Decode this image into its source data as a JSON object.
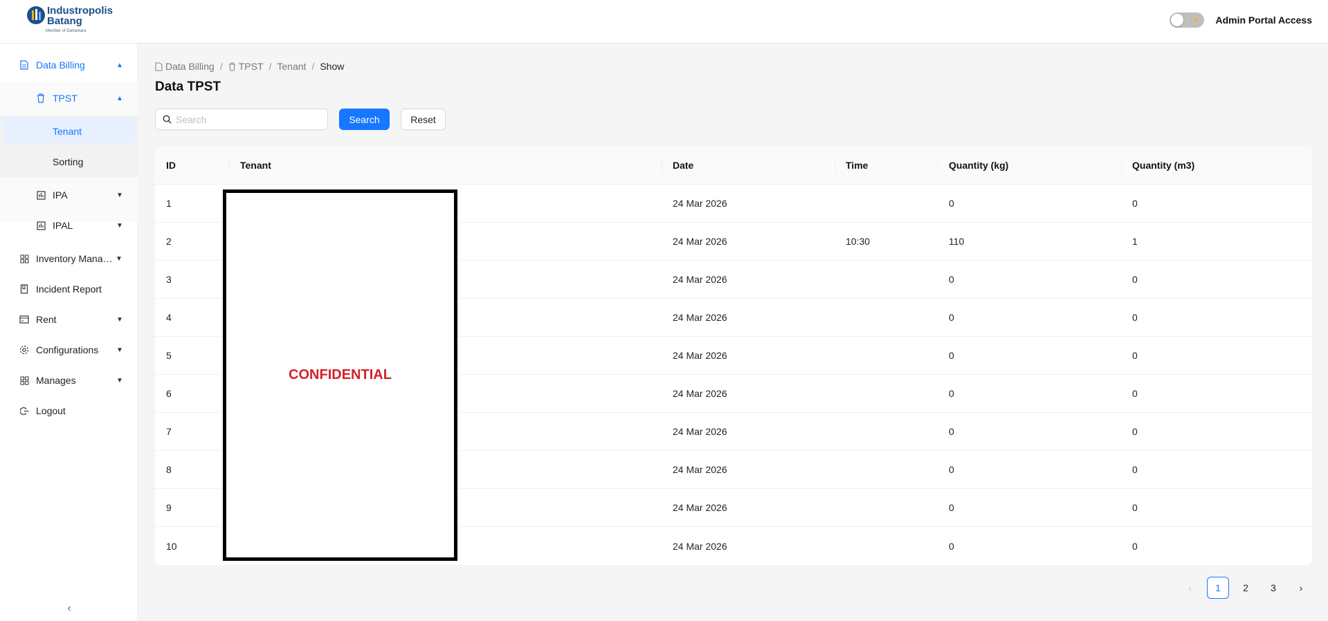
{
  "header": {
    "logo_line1": "Industropolis",
    "logo_line2": "Batang",
    "logo_sub": "Member of Danantara",
    "admin_label": "Admin Portal Access"
  },
  "sidebar": {
    "items": [
      {
        "label": "Data Billing",
        "icon": "document-icon"
      },
      {
        "label": "TPST",
        "icon": "trash-icon"
      },
      {
        "label": "Tenant"
      },
      {
        "label": "Sorting"
      },
      {
        "label": "IPA",
        "icon": "meter-icon"
      },
      {
        "label": "IPAL",
        "icon": "meter-icon"
      },
      {
        "label": "Inventory Management",
        "icon": "grid-icon"
      },
      {
        "label": "Incident Report",
        "icon": "book-icon"
      },
      {
        "label": "Rent",
        "icon": "card-icon"
      },
      {
        "label": "Configurations",
        "icon": "gear-icon"
      },
      {
        "label": "Manages",
        "icon": "grid-icon"
      },
      {
        "label": "Logout",
        "icon": "logout-icon"
      }
    ]
  },
  "breadcrumb": [
    "Data Billing",
    "TPST",
    "Tenant",
    "Show"
  ],
  "page_title": "Data TPST",
  "search": {
    "placeholder": "Search",
    "value": ""
  },
  "buttons": {
    "search": "Search",
    "reset": "Reset"
  },
  "table": {
    "columns": [
      "ID",
      "Tenant",
      "Date",
      "Time",
      "Quantity (kg)",
      "Quantity (m3)"
    ],
    "rows": [
      {
        "id": "1",
        "tenant": "",
        "date": "24 Mar 2026",
        "time": "",
        "kg": "0",
        "m3": "0"
      },
      {
        "id": "2",
        "tenant": "",
        "date": "24 Mar 2026",
        "time": "10:30",
        "kg": "110",
        "m3": "1"
      },
      {
        "id": "3",
        "tenant": "",
        "date": "24 Mar 2026",
        "time": "",
        "kg": "0",
        "m3": "0"
      },
      {
        "id": "4",
        "tenant": "",
        "date": "24 Mar 2026",
        "time": "",
        "kg": "0",
        "m3": "0"
      },
      {
        "id": "5",
        "tenant": "",
        "date": "24 Mar 2026",
        "time": "",
        "kg": "0",
        "m3": "0"
      },
      {
        "id": "6",
        "tenant": "",
        "date": "24 Mar 2026",
        "time": "",
        "kg": "0",
        "m3": "0"
      },
      {
        "id": "7",
        "tenant": "",
        "date": "24 Mar 2026",
        "time": "",
        "kg": "0",
        "m3": "0"
      },
      {
        "id": "8",
        "tenant": "",
        "date": "24 Mar 2026",
        "time": "",
        "kg": "0",
        "m3": "0"
      },
      {
        "id": "9",
        "tenant": "",
        "date": "24 Mar 2026",
        "time": "",
        "kg": "0",
        "m3": "0"
      },
      {
        "id": "10",
        "tenant": "",
        "date": "24 Mar 2026",
        "time": "",
        "kg": "0",
        "m3": "0"
      }
    ]
  },
  "redaction_label": "CONFIDENTIAL",
  "pagination": {
    "prev": "‹",
    "pages": [
      "1",
      "2",
      "3"
    ],
    "current": "1",
    "next": "›"
  },
  "colors": {
    "accent": "#1677ff",
    "redaction_text": "#d32029"
  }
}
